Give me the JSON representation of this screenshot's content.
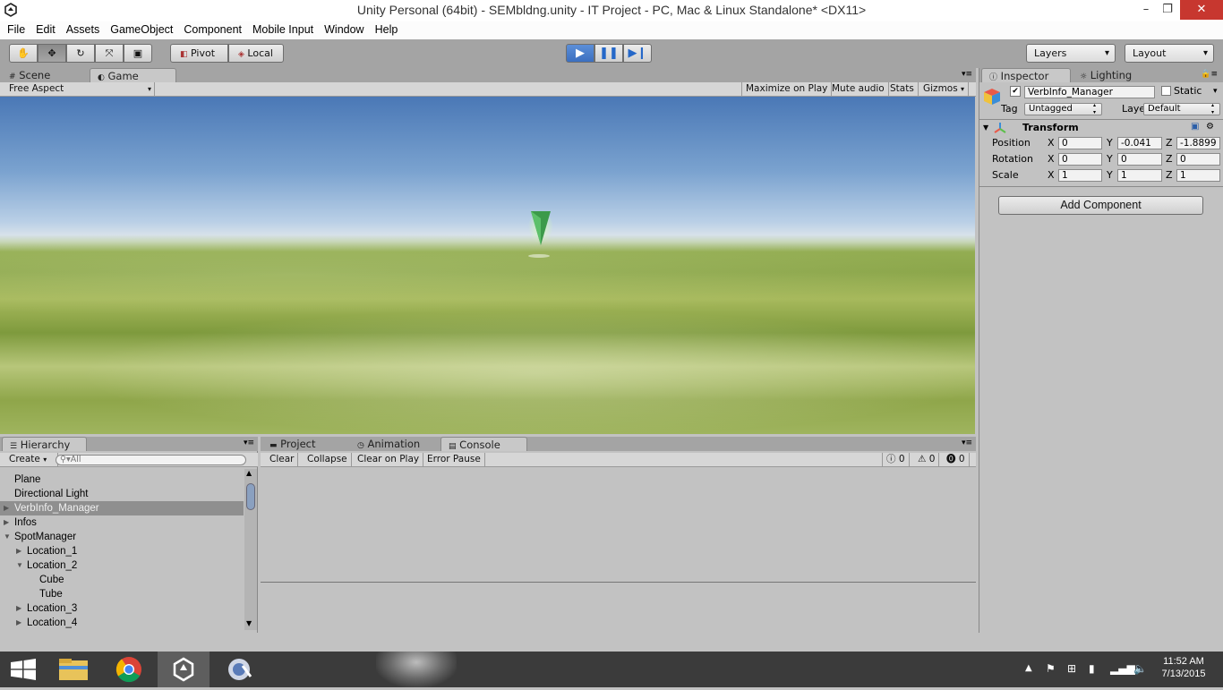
{
  "window": {
    "title": "Unity Personal (64bit) - SEMbldng.unity - IT Project - PC, Mac & Linux Standalone* <DX11>",
    "minimize": "–",
    "maximize": "❐",
    "close": "✕"
  },
  "menu": [
    "File",
    "Edit",
    "Assets",
    "GameObject",
    "Component",
    "Mobile Input",
    "Window",
    "Help"
  ],
  "toolbar": {
    "tools": [
      "hand-icon",
      "move-icon",
      "rotate-icon",
      "scale-icon",
      "rect-icon"
    ],
    "active_tool": "move-icon",
    "pivot": "Pivot",
    "local": "Local",
    "play_active": true,
    "layers": "Layers",
    "layout": "Layout"
  },
  "scene_panel": {
    "tabs": [
      "Scene",
      "Game"
    ],
    "active_tab": "Game",
    "aspect": "Free Aspect",
    "buttons": [
      "Maximize on Play",
      "Mute audio",
      "Stats",
      "Gizmos"
    ]
  },
  "inspector": {
    "tabs": [
      "Inspector",
      "Lighting"
    ],
    "object_name": "VerbInfo_Manager",
    "static_label": "Static",
    "tag_label": "Tag",
    "tag_value": "Untagged",
    "layer_label": "Layer",
    "layer_value": "Default",
    "transform": {
      "title": "Transform",
      "position": {
        "label": "Position",
        "x": "0",
        "y": "-0.041",
        "z": "-1.8899"
      },
      "rotation": {
        "label": "Rotation",
        "x": "0",
        "y": "0",
        "z": "0"
      },
      "scale": {
        "label": "Scale",
        "x": "1",
        "y": "1",
        "z": "1"
      }
    },
    "add_component": "Add Component"
  },
  "hierarchy": {
    "tab": "Hierarchy",
    "create": "Create",
    "search_placeholder": "All",
    "items": [
      {
        "label": "Plane",
        "indent": 0,
        "arrow": ""
      },
      {
        "label": "Directional Light",
        "indent": 0,
        "arrow": ""
      },
      {
        "label": "VerbInfo_Manager",
        "indent": 0,
        "arrow": "▶",
        "selected": true
      },
      {
        "label": "Infos",
        "indent": 0,
        "arrow": "▶"
      },
      {
        "label": "SpotManager",
        "indent": 0,
        "arrow": "▼"
      },
      {
        "label": "Location_1",
        "indent": 1,
        "arrow": "▶"
      },
      {
        "label": "Location_2",
        "indent": 1,
        "arrow": "▼"
      },
      {
        "label": "Cube",
        "indent": 2,
        "arrow": ""
      },
      {
        "label": "Tube",
        "indent": 2,
        "arrow": ""
      },
      {
        "label": "Location_3",
        "indent": 1,
        "arrow": "▶"
      },
      {
        "label": "Location_4",
        "indent": 1,
        "arrow": "▶"
      }
    ]
  },
  "console": {
    "tabs": [
      "Project",
      "Animation",
      "Console"
    ],
    "active_tab": "Console",
    "buttons": [
      "Clear",
      "Collapse",
      "Clear on Play",
      "Error Pause"
    ],
    "counts": {
      "info": "0",
      "warning": "0",
      "error": "0"
    }
  },
  "taskbar": {
    "time": "11:52 AM",
    "date": "7/13/2015"
  }
}
